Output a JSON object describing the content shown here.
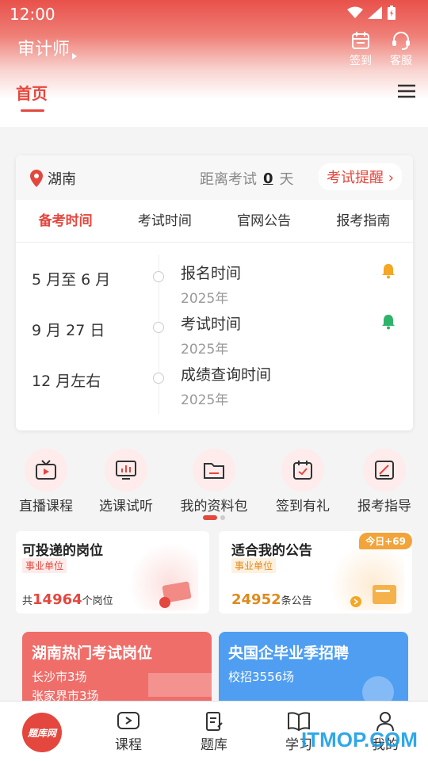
{
  "status_bar": {
    "time": "12:00"
  },
  "header": {
    "app_title": "审计师",
    "actions": [
      {
        "label": "签到",
        "icon": "calendar-icon"
      },
      {
        "label": "客服",
        "icon": "headset-icon"
      }
    ],
    "active_tab": "首页"
  },
  "exam_card": {
    "location": "湖南",
    "distance_prefix": "距离考试",
    "distance_days": "0",
    "distance_suffix": "天",
    "remind_label": "考试提醒",
    "tabs": [
      "备考时间",
      "考试时间",
      "官网公告",
      "报考指南"
    ],
    "timeline": [
      {
        "date": "5 月至 6 月",
        "title": "报名时间",
        "year": "2025年",
        "bell_color": "#f5a623"
      },
      {
        "date": "9 月 27 日",
        "title": "考试时间",
        "year": "2025年",
        "bell_color": "#2db46a"
      },
      {
        "date": "12 月左右",
        "title": "成绩查询时间",
        "year": "2025年",
        "bell_color": ""
      }
    ]
  },
  "quick_links": [
    {
      "label": "直播课程",
      "icon": "live-tv-icon"
    },
    {
      "label": "选课试听",
      "icon": "course-preview-icon"
    },
    {
      "label": "我的资料包",
      "icon": "folder-icon"
    },
    {
      "label": "签到有礼",
      "icon": "calendar-check-icon"
    },
    {
      "label": "报考指导",
      "icon": "guide-icon"
    }
  ],
  "info_cards": [
    {
      "title": "可投递的岗位",
      "tag": "事业单位",
      "count_prefix": "共",
      "count": "14964",
      "count_suffix": "个岗位",
      "count_color": "#e4473e"
    },
    {
      "title": "适合我的公告",
      "tag": "事业单位",
      "count_prefix": "",
      "count": "24952",
      "count_suffix": "条公告",
      "count_color": "#e08a1c",
      "badge": "今日+69"
    }
  ],
  "promos": [
    {
      "title": "湖南热门考试岗位",
      "lines": [
        "长沙市3场",
        "张家界市3场"
      ],
      "color": "#ef6e6a"
    },
    {
      "title": "央国企毕业季招聘",
      "lines": [
        "校招3556场"
      ],
      "color": "#4f9ef2"
    }
  ],
  "bottom_nav": [
    {
      "label": "题库网",
      "icon": "logo-icon"
    },
    {
      "label": "课程",
      "icon": "play-icon"
    },
    {
      "label": "题库",
      "icon": "document-icon"
    },
    {
      "label": "学习",
      "icon": "book-icon"
    },
    {
      "label": "我的",
      "icon": "user-icon"
    }
  ],
  "watermark": "ITMOP.COM"
}
